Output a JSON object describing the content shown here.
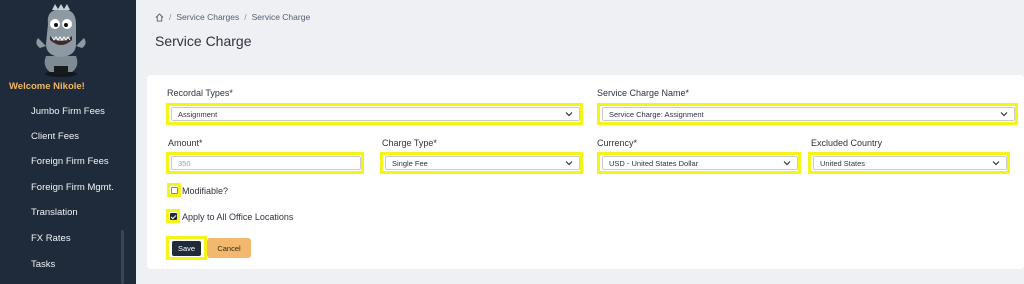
{
  "sidebar": {
    "mascot_icon": "dinosaur-mascot",
    "welcome": "Welcome Nikole!",
    "items": [
      {
        "label": "Jumbo Firm Fees"
      },
      {
        "label": "Client Fees"
      },
      {
        "label": "Foreign Firm Fees"
      },
      {
        "label": "Foreign Firm Mgmt."
      },
      {
        "label": "Translation"
      },
      {
        "label": "FX Rates"
      },
      {
        "label": "Tasks"
      }
    ]
  },
  "breadcrumb": {
    "home_icon": "home-icon",
    "items": [
      "Service Charges",
      "Service Charge"
    ],
    "separator": "/"
  },
  "page": {
    "title": "Service Charge"
  },
  "form": {
    "recordal_types": {
      "label": "Recordal Types*",
      "value": "Assignment"
    },
    "service_charge_name": {
      "label": "Service Charge Name*",
      "value": "Service Charge: Assignment"
    },
    "amount": {
      "label": "Amount*",
      "placeholder": "350"
    },
    "charge_type": {
      "label": "Charge Type*",
      "value": "Single Fee"
    },
    "currency": {
      "label": "Currency*",
      "value": "USD - United States Dollar"
    },
    "excluded_country": {
      "label": "Excluded Country",
      "value": "United States"
    },
    "modifiable": {
      "label": "Modifiable?",
      "checked": false
    },
    "apply_all": {
      "label": "Apply to All Office Locations",
      "checked": true
    },
    "save_label": "Save",
    "cancel_label": "Cancel"
  },
  "colors": {
    "sidebar_bg": "#1f2a3a",
    "highlight": "#f4f418",
    "welcome": "#f0b860",
    "cancel_bg": "#f1b86e"
  }
}
